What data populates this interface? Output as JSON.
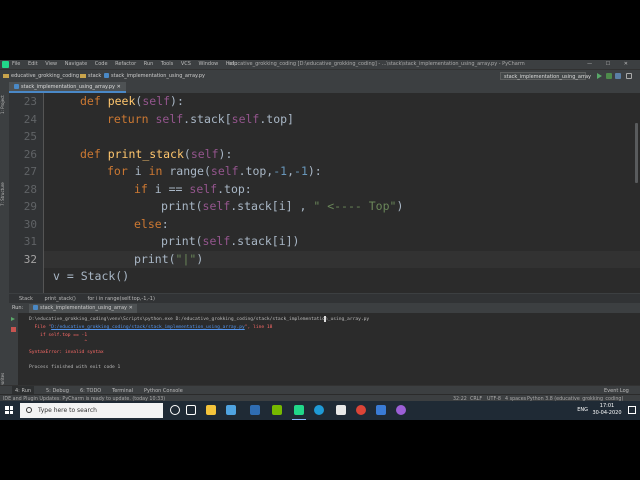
{
  "titlebar": {
    "menu": [
      "File",
      "Edit",
      "View",
      "Navigate",
      "Code",
      "Refactor",
      "Run",
      "Tools",
      "VCS",
      "Window",
      "Help"
    ],
    "window_title": "educative_grokking_coding [D:\\educative_grokking_coding] - ...\\stack\\stack_implementation_using_array.py - PyCharm",
    "controls": "— ☐ ✕"
  },
  "navbar": {
    "project": "educative_grokking_coding",
    "folder": "stack",
    "file": "stack_implementation_using_array.py",
    "run_config": "stack_implementation_using_array"
  },
  "left_strip": {
    "project_label": "1: Project",
    "structure_label": "7: Structure",
    "favorites_label": "2: Favorites"
  },
  "editor": {
    "tab_label": "stack_implementation_using_array.py",
    "current_line": "32",
    "lines": [
      {
        "num": "23",
        "text": "def peek(self):"
      },
      {
        "num": "24",
        "text": "return self.stack[self.top]"
      },
      {
        "num": "25",
        "text": ""
      },
      {
        "num": "26",
        "text": "def print_stack(self):"
      },
      {
        "num": "27",
        "text": "for i in range(self.top,-1,-1):"
      },
      {
        "num": "28",
        "text": "if i == self.top:"
      },
      {
        "num": "29",
        "text": "print(self.stack[i] , \" <---- Top\")"
      },
      {
        "num": "30",
        "text": "else:"
      },
      {
        "num": "31",
        "text": "print(self.stack[i])"
      },
      {
        "num": "32",
        "text": "print(\"|\")"
      },
      {
        "num": "",
        "text": "v = Stack()"
      }
    ],
    "breadcrumb": [
      "Stack",
      "print_stack()",
      "for i in range(self.top,-1,-1)"
    ]
  },
  "run_panel": {
    "label": "Run:",
    "tab": "stack_implementation_using_array",
    "output": {
      "command": "D:\\educative_grokking_coding\\venv\\Scripts\\python.exe D:/educative_grokking_coding/stack/stack_implementation_using_array.py",
      "file_prefix": "  File \"",
      "file_link": "D:/educative_grokking_coding/stack/stack_implementation_using_array.py",
      "file_suffix": "\", line 18",
      "code_line": "    if self.top == -1",
      "caret": "                    ^",
      "error": "SyntaxError: invalid syntax",
      "exit": "Process finished with exit code 1"
    }
  },
  "bottom_tabs": {
    "run": "4: Run",
    "debug": "5: Debug",
    "todo": "6: TODO",
    "terminal": "Terminal",
    "console": "Python Console",
    "event_log": "Event Log"
  },
  "statusbar": {
    "message": "IDE and Plugin Updates: PyCharm is ready to update. (today 10:33)",
    "position": "32:22",
    "line_sep": "CRLF",
    "encoding": "UTF-8",
    "indent": "4 spaces",
    "interpreter": "Python 3.8 (educative_grokking_coding)"
  },
  "taskbar": {
    "search_placeholder": "Type here to search",
    "lang": "ENG",
    "time": "17:01",
    "date": "30-04-2020"
  },
  "colors": {
    "editor_bg": "#2b2b2b",
    "keyword": "#cc7832",
    "function": "#ffc66d",
    "self": "#94558d",
    "string": "#6a8759",
    "number": "#6897bb",
    "error": "#ff6b68"
  }
}
